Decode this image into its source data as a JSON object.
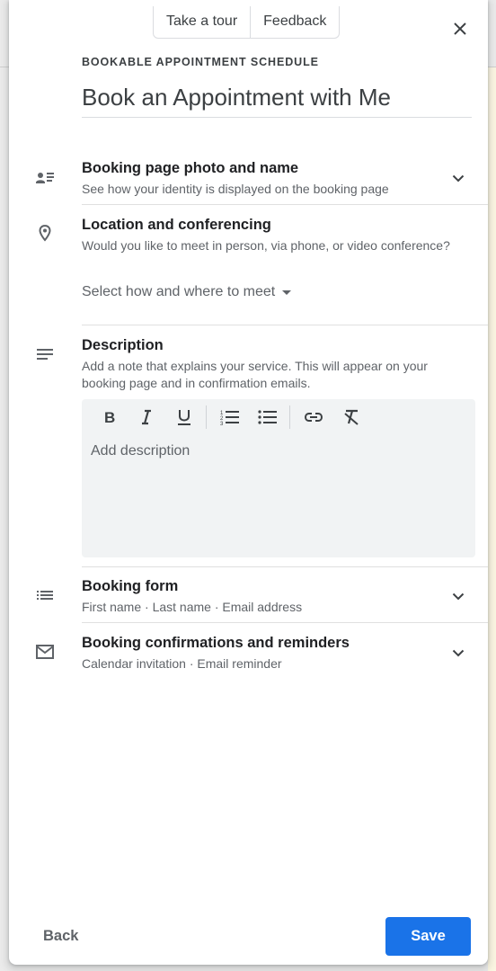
{
  "header": {
    "take_tour": "Take a tour",
    "feedback": "Feedback",
    "overline": "BOOKABLE APPOINTMENT SCHEDULE",
    "title_value": "Book an Appointment with Me"
  },
  "sections": {
    "booking_page": {
      "title": "Booking page photo and name",
      "subtitle": "See how your identity is displayed on the booking page",
      "icon": "person-list-icon"
    },
    "location": {
      "title": "Location and conferencing",
      "subtitle": "Would you like to meet in person, via phone, or video conference?",
      "icon": "location-pin-icon",
      "select_value": "Select how and where to meet"
    },
    "description": {
      "title": "Description",
      "subtitle": "Add a note that explains your service. This will appear on your booking page and in confirmation emails.",
      "icon": "notes-icon",
      "placeholder": "Add description",
      "toolbar": [
        "bold-icon",
        "italic-icon",
        "underline-icon",
        "numbered-list-icon",
        "bulleted-list-icon",
        "link-icon",
        "clear-format-icon"
      ]
    },
    "booking_form": {
      "title": "Booking form",
      "subtitle": "First name · Last name · Email address",
      "icon": "list-icon"
    },
    "confirmations": {
      "title": "Booking confirmations and reminders",
      "subtitle": "Calendar invitation · Email reminder",
      "icon": "mail-icon"
    }
  },
  "footer": {
    "back": "Back",
    "save": "Save"
  },
  "colors": {
    "accent": "#1a73e8",
    "text_primary": "#202124",
    "text_secondary": "#5f6368"
  }
}
